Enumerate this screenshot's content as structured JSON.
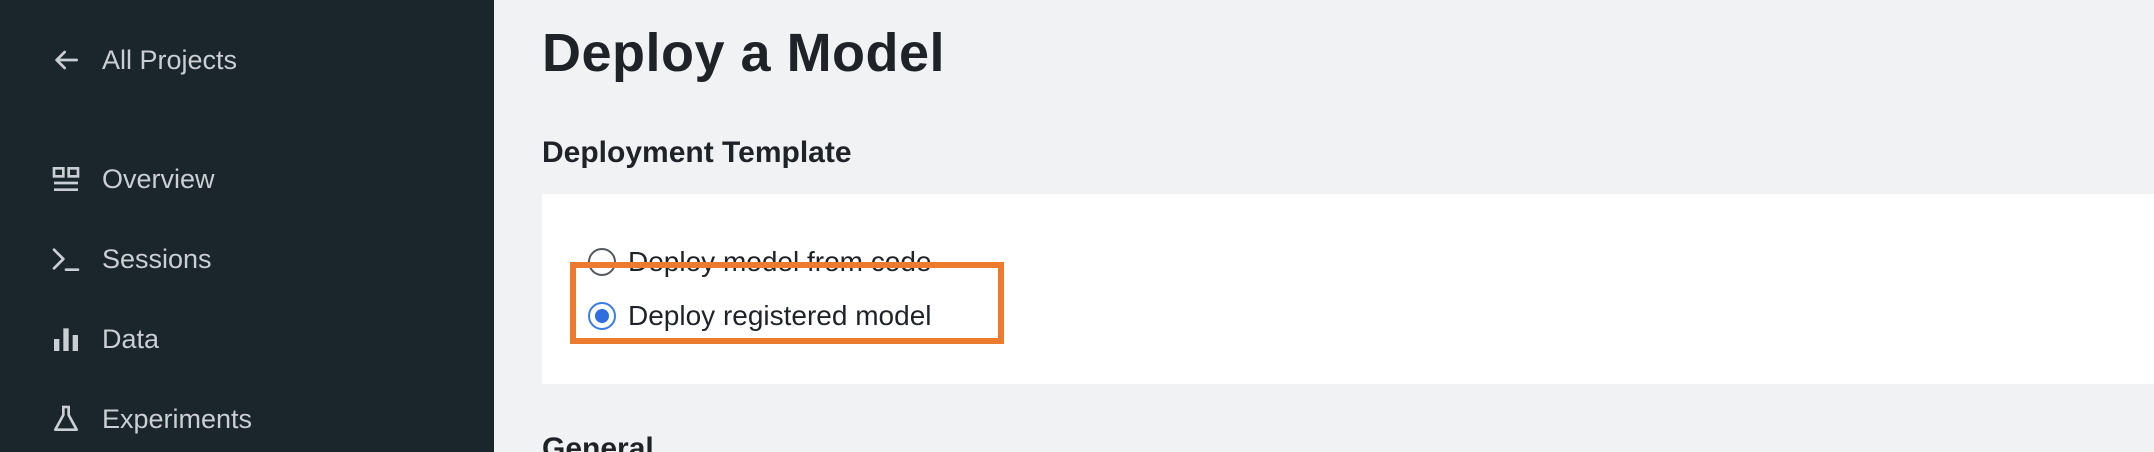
{
  "sidebar": {
    "back_label": "All Projects",
    "items": [
      {
        "label": "Overview",
        "icon": "overview-icon"
      },
      {
        "label": "Sessions",
        "icon": "terminal-icon"
      },
      {
        "label": "Data",
        "icon": "bar-chart-icon"
      },
      {
        "label": "Experiments",
        "icon": "flask-icon"
      }
    ]
  },
  "main": {
    "title": "Deploy a Model",
    "template_section": {
      "title": "Deployment Template",
      "options": [
        {
          "label": "Deploy model from code",
          "selected": false
        },
        {
          "label": "Deploy registered model",
          "selected": true
        }
      ]
    },
    "general_section_title": "General"
  },
  "colors": {
    "sidebar_bg": "#1b252c",
    "highlight": "#ec7b2f",
    "radio_selected": "#2f6fe0"
  }
}
